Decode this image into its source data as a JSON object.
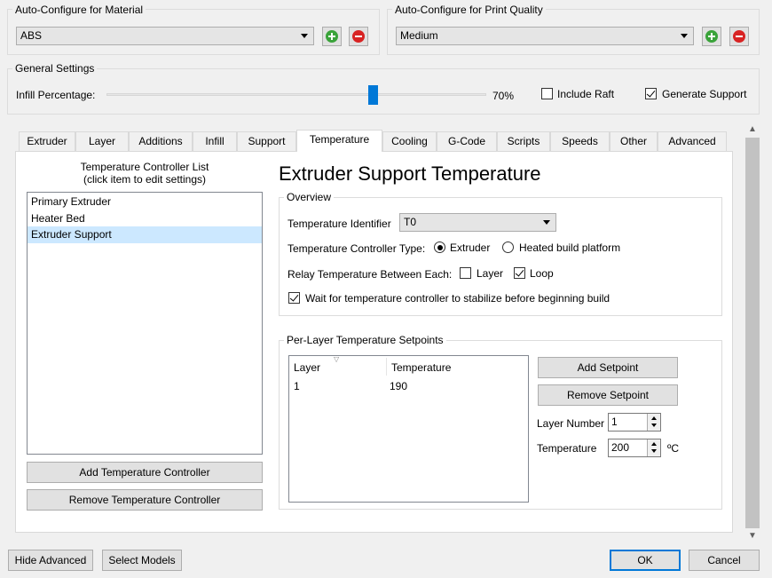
{
  "material": {
    "group_title": "Auto-Configure for Material",
    "selected": "ABS"
  },
  "quality": {
    "group_title": "Auto-Configure for Print Quality",
    "selected": "Medium"
  },
  "general": {
    "group_title": "General Settings",
    "infill_label": "Infill Percentage:",
    "infill_value": "70%",
    "infill_fraction": 0.7,
    "include_raft_label": "Include Raft",
    "include_raft_checked": false,
    "generate_support_label": "Generate Support",
    "generate_support_checked": true
  },
  "tabs": [
    {
      "label": "Extruder"
    },
    {
      "label": "Layer"
    },
    {
      "label": "Additions"
    },
    {
      "label": "Infill"
    },
    {
      "label": "Support"
    },
    {
      "label": "Temperature",
      "active": true
    },
    {
      "label": "Cooling"
    },
    {
      "label": "G-Code"
    },
    {
      "label": "Scripts"
    },
    {
      "label": "Speeds"
    },
    {
      "label": "Other"
    },
    {
      "label": "Advanced"
    }
  ],
  "controller_list": {
    "title_line1": "Temperature Controller List",
    "title_line2": "(click item to edit settings)",
    "items": [
      "Primary Extruder",
      "Heater Bed",
      "Extruder Support"
    ],
    "selected_index": 2,
    "add_button": "Add Temperature Controller",
    "remove_button": "Remove Temperature Controller"
  },
  "detail": {
    "heading": "Extruder Support Temperature",
    "overview_title": "Overview",
    "identifier_label": "Temperature Identifier",
    "identifier_value": "T0",
    "type_label": "Temperature Controller Type:",
    "type_extruder": "Extruder",
    "type_heated": "Heated build platform",
    "relay_label": "Relay Temperature Between Each:",
    "relay_layer": "Layer",
    "relay_loop": "Loop",
    "wait_label": "Wait for temperature controller to stabilize before beginning build"
  },
  "setpoints": {
    "group_title": "Per-Layer Temperature Setpoints",
    "col_layer": "Layer",
    "col_temperature": "Temperature",
    "rows": [
      {
        "layer": "1",
        "temperature": "190"
      }
    ],
    "add_button": "Add Setpoint",
    "remove_button": "Remove Setpoint",
    "layer_number_label": "Layer Number",
    "layer_number_value": "1",
    "temperature_label": "Temperature",
    "temperature_value": "200",
    "temperature_unit": "ºC"
  },
  "footer": {
    "hide_advanced": "Hide Advanced",
    "select_models": "Select Models",
    "ok": "OK",
    "cancel": "Cancel"
  }
}
